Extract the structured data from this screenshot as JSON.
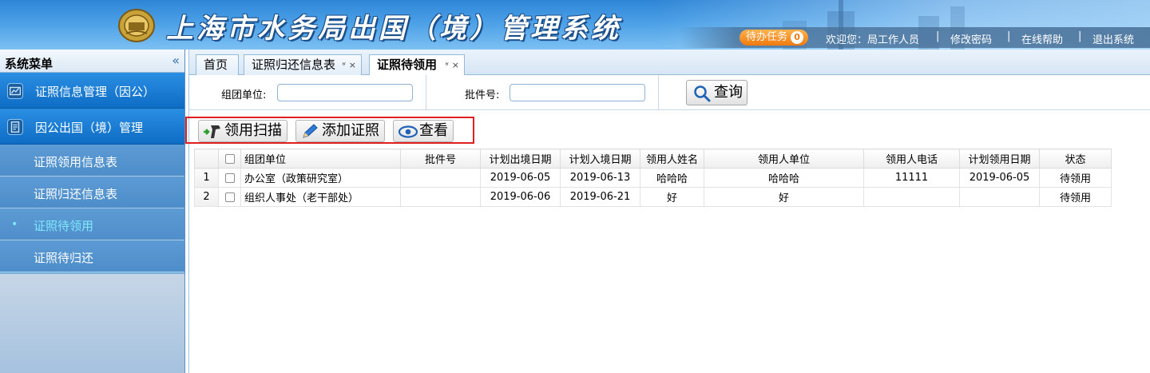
{
  "header": {
    "title": "上海市水务局出国（境）管理系统",
    "task_label": "待办任务",
    "task_count": "0",
    "welcome": "欢迎您：局工作人员",
    "links": [
      "修改密码",
      "在线帮助",
      "退出系统"
    ]
  },
  "sidebar": {
    "title": "系统菜单",
    "collapse_icon": "double-chevron-left-icon",
    "groups": [
      {
        "label": "证照信息管理（因公）",
        "icon": "chart-icon"
      },
      {
        "label": "因公出国（境）管理",
        "icon": "document-icon"
      }
    ],
    "items": [
      {
        "label": "证照领用信息表",
        "active": false
      },
      {
        "label": "证照归还信息表",
        "active": false
      },
      {
        "label": "证照待领用",
        "active": true
      },
      {
        "label": "证照待归还",
        "active": false
      }
    ]
  },
  "tabs": [
    {
      "label": "首页",
      "closable": false,
      "active": false
    },
    {
      "label": "证照归还信息表",
      "closable": true,
      "active": false
    },
    {
      "label": "证照待领用",
      "closable": true,
      "active": true
    }
  ],
  "tab_close_glyph": "ʶ ×",
  "search": {
    "group_unit_label": "组团单位:",
    "group_unit_value": "",
    "batch_no_label": "批件号:",
    "batch_no_value": "",
    "query_button": "查询"
  },
  "toolbar": {
    "scan_button": "领用扫描",
    "add_button": "添加证照",
    "view_button": "查看"
  },
  "table": {
    "columns": [
      "组团单位",
      "批件号",
      "计划出境日期",
      "计划入境日期",
      "领用人姓名",
      "领用人单位",
      "领用人电话",
      "计划领用日期",
      "状态"
    ],
    "rows": [
      {
        "num": "1",
        "cells": [
          "办公室（政策研究室）",
          "",
          "2019-06-05",
          "2019-06-13",
          "哈哈哈",
          "哈哈哈",
          "11111",
          "2019-06-05",
          "待领用"
        ]
      },
      {
        "num": "2",
        "cells": [
          "组织人事处（老干部处）",
          "",
          "2019-06-06",
          "2019-06-21",
          "好",
          "好",
          "",
          "",
          "待领用"
        ]
      }
    ]
  },
  "colors": {
    "header_blue": "#2f86d6",
    "menu_group_blue": "#0e6cc4",
    "active_item_text": "#7fe8ff",
    "task_orange": "#f07a10",
    "highlight_red": "#e02020"
  }
}
